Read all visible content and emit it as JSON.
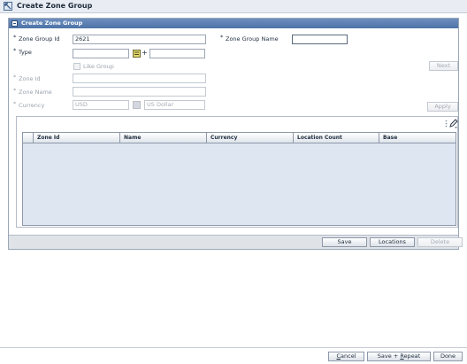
{
  "window": {
    "title": "Create Zone Group"
  },
  "panel": {
    "title": "Create Zone Group"
  },
  "form": {
    "zone_group_id": {
      "label": "Zone Group Id",
      "value": "2621"
    },
    "zone_group_name": {
      "label": "Zone Group Name",
      "value": ""
    },
    "type": {
      "label": "Type",
      "value": "",
      "desc_value": ""
    },
    "like_group": {
      "label": "Like Group"
    },
    "zone_id": {
      "label": "Zone Id",
      "value": ""
    },
    "zone_name": {
      "label": "Zone Name",
      "value": ""
    },
    "currency": {
      "label": "Currency",
      "code": "USD",
      "name": "US Dollar"
    },
    "required_mark": "*",
    "plus_sign": "+"
  },
  "buttons": {
    "next": "Next",
    "apply": "Apply",
    "save": "Save",
    "locations": "Locations",
    "delete": "Delete",
    "cancel_pre": "",
    "cancel_u": "C",
    "cancel_post": "ancel",
    "save_repeat_pre": "Save + ",
    "save_repeat_u": "R",
    "save_repeat_post": "epeat",
    "done": "Done"
  },
  "table": {
    "columns": [
      "Zone Id",
      "Name",
      "Currency",
      "Location Count",
      "Base"
    ],
    "rows": []
  }
}
